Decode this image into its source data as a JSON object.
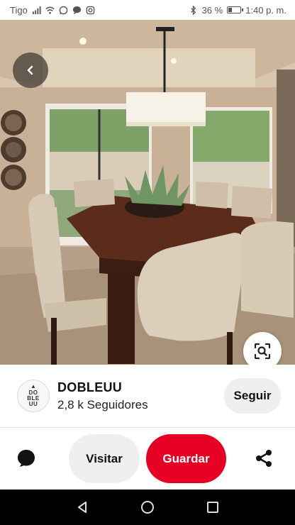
{
  "status_bar": {
    "carrier": "Tigo",
    "battery_text": "36 %",
    "battery_level": 0.36,
    "time": "1:40 p. m.",
    "icons": [
      "signal-icon",
      "wifi-icon",
      "whatsapp-icon",
      "message-icon",
      "instagram-icon",
      "bluetooth-icon",
      "battery-icon"
    ]
  },
  "pin": {
    "image_description_icon": "dining-room-photo",
    "back_icon": "chevron-left-icon",
    "lens_icon": "visual-search-icon"
  },
  "profile": {
    "avatar_text": [
      "DO",
      "BLE",
      "UU"
    ],
    "name": "DOBLEUU",
    "followers": "2,8 k Seguidores",
    "follow_label": "Seguir"
  },
  "actions": {
    "comment_icon": "comment-icon",
    "visit_label": "Visitar",
    "save_label": "Guardar",
    "save_color": "#e60023",
    "share_icon": "share-icon"
  },
  "nav": {
    "icons": [
      "back-triangle-icon",
      "home-circle-icon",
      "recents-square-icon"
    ]
  }
}
